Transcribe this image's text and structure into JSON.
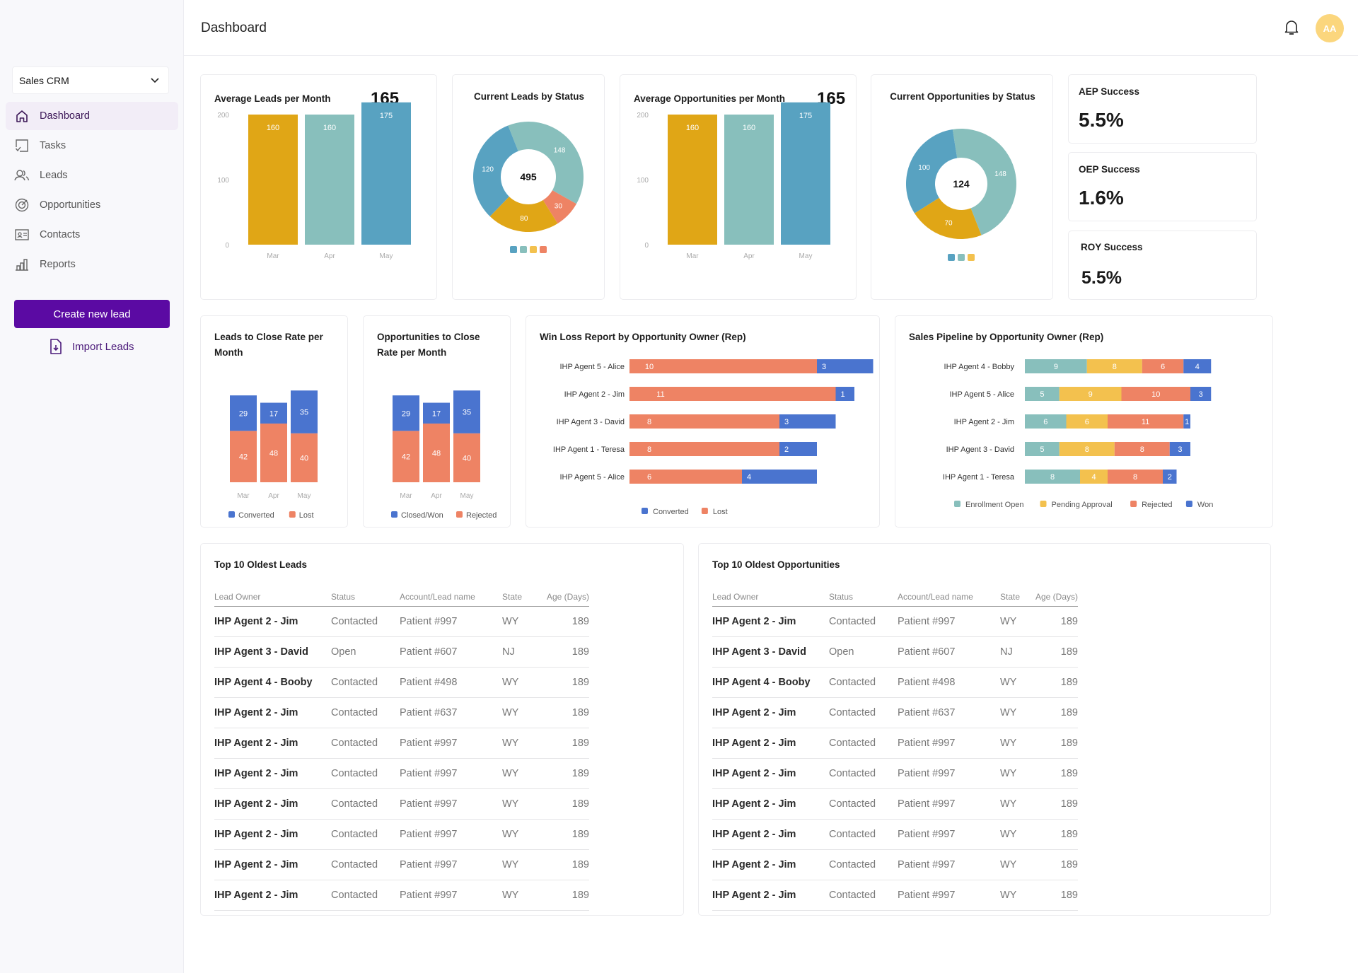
{
  "sidebar": {
    "workspace": "Sales CRM",
    "nav": [
      {
        "label": "Dashboard",
        "icon": "home-icon",
        "active": true
      },
      {
        "label": "Tasks",
        "icon": "tasks-icon"
      },
      {
        "label": "Leads",
        "icon": "users-icon"
      },
      {
        "label": "Opportunities",
        "icon": "target-icon"
      },
      {
        "label": "Contacts",
        "icon": "contact-card-icon"
      },
      {
        "label": "Reports",
        "icon": "bar-chart-icon"
      }
    ],
    "create_button": "Create new lead",
    "import_link": "Import Leads"
  },
  "header": {
    "title": "Dashboard",
    "avatar_initials": "AA"
  },
  "colors": {
    "yellow": "#e0a616",
    "teal": "#88bfbc",
    "blue": "#58a2c1",
    "orange": "#ee8364",
    "indigo": "#4a74cf",
    "gold": "#f3c14e",
    "purple": "#5b0aa3"
  },
  "kpis": [
    {
      "label": "AEP Success",
      "value": "5.5%"
    },
    {
      "label": "OEP Success",
      "value": "1.6%"
    },
    {
      "label": "ROY Success",
      "value": "5.5%"
    }
  ],
  "chart_data": [
    {
      "id": "avg-leads",
      "type": "bar",
      "title": "Average Leads per Month",
      "headline": "165",
      "categories": [
        "Mar",
        "Apr",
        "May"
      ],
      "values": [
        160,
        160,
        175
      ],
      "yticks": [
        "0",
        "100",
        "200"
      ],
      "ylim": [
        0,
        200
      ]
    },
    {
      "id": "leads-status",
      "type": "pie",
      "title": "Current Leads by Status",
      "center_label": "495",
      "slices": [
        {
          "value": 148,
          "color": "teal"
        },
        {
          "value": 30,
          "color": "orange"
        },
        {
          "value": 80,
          "color": "yellow"
        },
        {
          "value": 120,
          "color": "blue"
        }
      ],
      "legend_colors": [
        "blue",
        "teal",
        "gold",
        "orange"
      ]
    },
    {
      "id": "avg-opps",
      "type": "bar",
      "title": "Average Opportunities per Month",
      "headline": "165",
      "categories": [
        "Mar",
        "Apr",
        "May"
      ],
      "values": [
        160,
        160,
        175
      ],
      "yticks": [
        "0",
        "100",
        "200"
      ],
      "ylim": [
        0,
        200
      ]
    },
    {
      "id": "opps-status",
      "type": "pie",
      "title": "Current Opportunities by Status",
      "center_label": "124",
      "slices": [
        {
          "value": 148,
          "color": "teal"
        },
        {
          "value": 70,
          "color": "yellow"
        },
        {
          "value": 100,
          "color": "blue"
        }
      ],
      "legend_colors": [
        "blue",
        "teal",
        "gold"
      ]
    },
    {
      "id": "leads-close",
      "type": "bar",
      "stacked": true,
      "title": "Leads to Close Rate per Month",
      "categories": [
        "Mar",
        "Apr",
        "May"
      ],
      "series": [
        {
          "name": "Converted",
          "values": [
            29,
            17,
            35
          ],
          "color": "indigo"
        },
        {
          "name": "Lost",
          "values": [
            42,
            48,
            40
          ],
          "color": "orange"
        }
      ]
    },
    {
      "id": "opps-close",
      "type": "bar",
      "stacked": true,
      "title": "Opportunities to Close Rate per Month",
      "categories": [
        "Mar",
        "Apr",
        "May"
      ],
      "series": [
        {
          "name": "Closed/Won",
          "values": [
            29,
            17,
            35
          ],
          "color": "indigo"
        },
        {
          "name": "Rejected",
          "values": [
            42,
            48,
            40
          ],
          "color": "orange"
        }
      ]
    },
    {
      "id": "win-loss",
      "type": "bar",
      "horizontal": true,
      "stacked": true,
      "title": "Win Loss Report by Opportunity Owner (Rep)",
      "categories": [
        "IHP Agent 5 - Alice",
        "IHP Agent 2 - Jim",
        "IHP Agent 3 - David",
        "IHP Agent 1 - Teresa",
        "IHP Agent 5 - Alice"
      ],
      "series": [
        {
          "name": "Lost",
          "values": [
            10,
            11,
            8,
            8,
            6
          ],
          "color": "orange"
        },
        {
          "name": "Converted",
          "values": [
            3,
            1,
            3,
            2,
            4
          ],
          "color": "indigo"
        }
      ],
      "legend": [
        {
          "name": "Converted",
          "color": "indigo"
        },
        {
          "name": "Lost",
          "color": "orange"
        }
      ]
    },
    {
      "id": "pipeline",
      "type": "bar",
      "horizontal": true,
      "stacked": true,
      "title": "Sales Pipeline by Opportunity Owner (Rep)",
      "categories": [
        "IHP Agent 4 - Bobby",
        "IHP Agent 5 - Alice",
        "IHP Agent 2 - Jim",
        "IHP Agent 3 - David",
        "IHP Agent 1 - Teresa"
      ],
      "series": [
        {
          "name": "Enrollment Open",
          "values": [
            9,
            5,
            6,
            5,
            8
          ],
          "color": "teal"
        },
        {
          "name": "Pending Approval",
          "values": [
            8,
            9,
            6,
            8,
            4
          ],
          "color": "gold"
        },
        {
          "name": "Rejected",
          "values": [
            6,
            10,
            11,
            8,
            8
          ],
          "color": "orange"
        },
        {
          "name": "Won",
          "values": [
            4,
            3,
            1,
            3,
            2
          ],
          "color": "indigo"
        }
      ]
    }
  ],
  "tables": [
    {
      "title": "Top 10 Oldest Leads",
      "columns": [
        "Lead Owner",
        "Status",
        "Account/Lead name",
        "State",
        "Age (Days)"
      ],
      "rows": [
        [
          "IHP Agent 2 - Jim",
          "Contacted",
          "Patient #997",
          "WY",
          "189"
        ],
        [
          "IHP Agent 3 - David",
          "Open",
          "Patient #607",
          "NJ",
          "189"
        ],
        [
          "IHP Agent 4 - Booby",
          "Contacted",
          "Patient #498",
          "WY",
          "189"
        ],
        [
          "IHP Agent 2 - Jim",
          "Contacted",
          "Patient #637",
          "WY",
          "189"
        ],
        [
          "IHP Agent 2 - Jim",
          "Contacted",
          "Patient #997",
          "WY",
          "189"
        ],
        [
          "IHP Agent 2 - Jim",
          "Contacted",
          "Patient #997",
          "WY",
          "189"
        ],
        [
          "IHP Agent 2 - Jim",
          "Contacted",
          "Patient #997",
          "WY",
          "189"
        ],
        [
          "IHP Agent 2 - Jim",
          "Contacted",
          "Patient #997",
          "WY",
          "189"
        ],
        [
          "IHP Agent 2 - Jim",
          "Contacted",
          "Patient #997",
          "WY",
          "189"
        ],
        [
          "IHP Agent 2 - Jim",
          "Contacted",
          "Patient #997",
          "WY",
          "189"
        ]
      ]
    },
    {
      "title": "Top 10 Oldest Opportunities",
      "columns": [
        "Lead Owner",
        "Status",
        "Account/Lead name",
        "State",
        "Age (Days)"
      ],
      "rows": [
        [
          "IHP Agent 2 - Jim",
          "Contacted",
          "Patient #997",
          "WY",
          "189"
        ],
        [
          "IHP Agent 3 - David",
          "Open",
          "Patient #607",
          "NJ",
          "189"
        ],
        [
          "IHP Agent 4 - Booby",
          "Contacted",
          "Patient #498",
          "WY",
          "189"
        ],
        [
          "IHP Agent 2 - Jim",
          "Contacted",
          "Patient #637",
          "WY",
          "189"
        ],
        [
          "IHP Agent 2 - Jim",
          "Contacted",
          "Patient #997",
          "WY",
          "189"
        ],
        [
          "IHP Agent 2 - Jim",
          "Contacted",
          "Patient #997",
          "WY",
          "189"
        ],
        [
          "IHP Agent 2 - Jim",
          "Contacted",
          "Patient #997",
          "WY",
          "189"
        ],
        [
          "IHP Agent 2 - Jim",
          "Contacted",
          "Patient #997",
          "WY",
          "189"
        ],
        [
          "IHP Agent 2 - Jim",
          "Contacted",
          "Patient #997",
          "WY",
          "189"
        ],
        [
          "IHP Agent 2 - Jim",
          "Contacted",
          "Patient #997",
          "WY",
          "189"
        ]
      ]
    }
  ]
}
